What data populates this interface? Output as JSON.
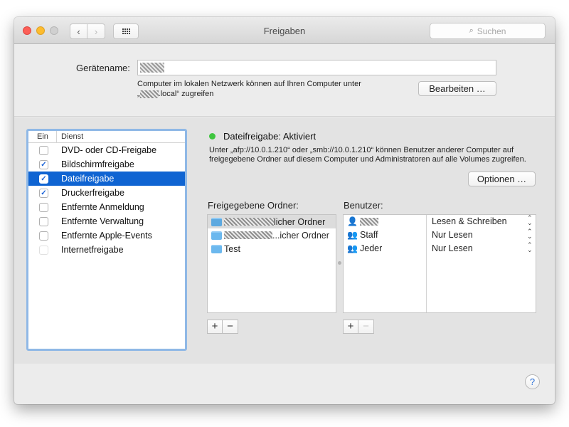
{
  "window": {
    "title": "Freigaben",
    "search_placeholder": "Suchen"
  },
  "top": {
    "device_label": "Gerätename:",
    "hint_line1": "Computer im lokalen Netzwerk können auf Ihren Computer unter",
    "hint_line2_suffix": ".local“ zugreifen",
    "hint_line2_prefix": "„",
    "edit_button": "Bearbeiten …"
  },
  "services": {
    "header_on": "Ein",
    "header_service": "Dienst",
    "items": [
      {
        "label": "DVD- oder CD-Freigabe",
        "checked": false
      },
      {
        "label": "Bildschirmfreigabe",
        "checked": true
      },
      {
        "label": "Dateifreigabe",
        "checked": true,
        "selected": true
      },
      {
        "label": "Druckerfreigabe",
        "checked": true
      },
      {
        "label": "Entfernte Anmeldung",
        "checked": false
      },
      {
        "label": "Entfernte Verwaltung",
        "checked": false
      },
      {
        "label": "Entfernte Apple-Events",
        "checked": false
      },
      {
        "label": "Internetfreigabe",
        "checked": false,
        "disabled": true
      }
    ]
  },
  "detail": {
    "status": "Dateifreigabe: Aktiviert",
    "status_color": "#3fc63f",
    "description": "Unter „afp://10.0.1.210“ oder „smb://10.0.1.210“ können Benutzer anderer Computer auf freigegebene Ordner auf diesem Computer und Administratoren auf alle Volumes zugreifen.",
    "options_button": "Optionen …",
    "folders_label": "Freigegebene Ordner:",
    "users_label": "Benutzer:",
    "folders": [
      {
        "label_suffix": "licher Ordner"
      },
      {
        "label_suffix": "...icher Ordner"
      },
      {
        "label": "Test"
      }
    ],
    "users": [
      {
        "name": "",
        "permission": "Lesen & Schreiben",
        "icon": "single-user-icon"
      },
      {
        "name": "Staff",
        "permission": "Nur Lesen",
        "icon": "group-icon"
      },
      {
        "name": "Jeder",
        "permission": "Nur Lesen",
        "icon": "everyone-icon"
      }
    ],
    "add_symbol": "+",
    "remove_symbol": "−"
  },
  "help_symbol": "?"
}
